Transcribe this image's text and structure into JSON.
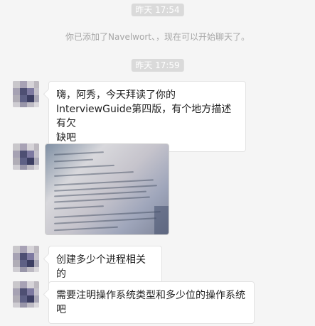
{
  "chat": {
    "timestamps": [
      "昨天 17:54",
      "昨天 17:59"
    ],
    "system_message": "你已添加了Navelwort、，现在可以开始聊天了。",
    "messages": [
      {
        "type": "text",
        "lines": [
          "嗨，阿秀，今天拜读了你的",
          "InterviewGuide第四版，有个地方描述有欠",
          "缺吧"
        ]
      },
      {
        "type": "image",
        "image_description": "photo-of-book-page"
      },
      {
        "type": "text",
        "lines": [
          "创建多少个进程相关的"
        ]
      },
      {
        "type": "text",
        "lines": [
          "需要注明操作系统类型和多少位的操作系统",
          "吧"
        ]
      }
    ]
  },
  "colors": {
    "background": "#f5f5f5",
    "timestamp_bg": "#dadada",
    "bubble_bg": "#ffffff",
    "text": "#222222",
    "system_text": "#a6a6a6"
  }
}
